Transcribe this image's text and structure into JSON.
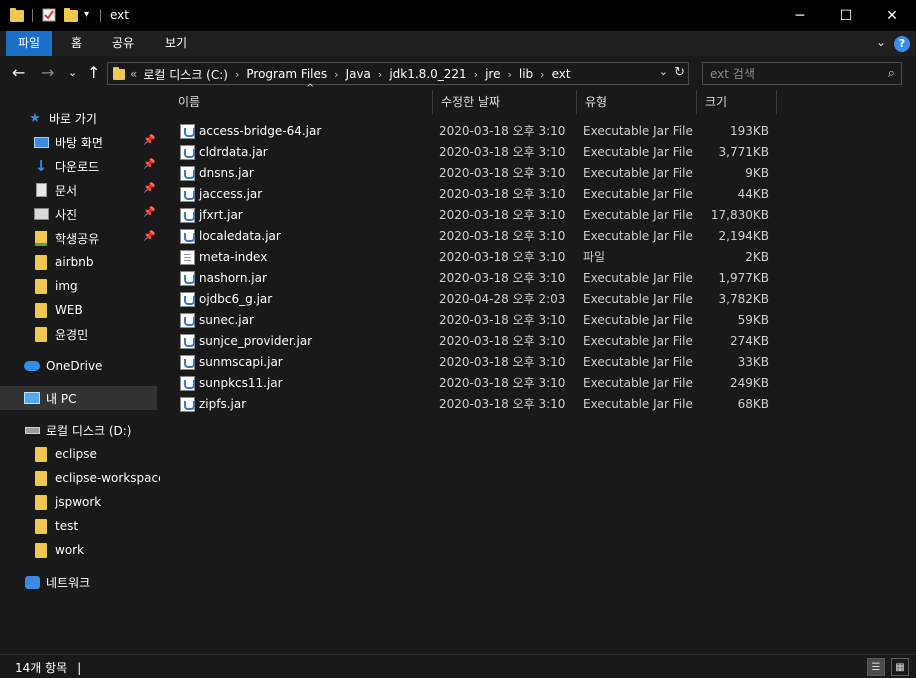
{
  "window": {
    "title": "ext",
    "minimize": "─",
    "maximize": "☐",
    "close": "✕"
  },
  "ribbon": {
    "tabs": [
      {
        "label": "파일",
        "active": true
      },
      {
        "label": "홈"
      },
      {
        "label": "공유"
      },
      {
        "label": "보기"
      }
    ],
    "help": "?"
  },
  "address": {
    "overflow": "«",
    "crumbs": [
      "로컬 디스크 (C:)",
      "Program Files",
      "Java",
      "jdk1.8.0_221",
      "jre",
      "lib",
      "ext"
    ]
  },
  "search": {
    "placeholder": "ext 검색"
  },
  "sidebar": {
    "quick_access": "바로 가기",
    "pinned": [
      {
        "label": "바탕 화면",
        "icon": "desktop-icon"
      },
      {
        "label": "다운로드",
        "icon": "download-icon"
      },
      {
        "label": "문서",
        "icon": "document-icon"
      },
      {
        "label": "사진",
        "icon": "pictures-icon"
      },
      {
        "label": "학생공유",
        "icon": "shared-folder-icon"
      }
    ],
    "folders": [
      "airbnb",
      "img",
      "WEB",
      "윤경민"
    ],
    "onedrive": "OneDrive",
    "this_pc": "내 PC",
    "drive": "로컬 디스크 (D:)",
    "drive_folders": [
      "eclipse",
      "eclipse-workspace",
      "jspwork",
      "test",
      "work"
    ],
    "network": "네트워크"
  },
  "columns": {
    "name": "이름",
    "date": "수정한 날짜",
    "type": "유형",
    "size": "크기"
  },
  "files": [
    {
      "name": "access-bridge-64.jar",
      "date": "2020-03-18 오후 3:10",
      "type": "Executable Jar File",
      "size": "193KB",
      "icon": "jar-icon"
    },
    {
      "name": "cldrdata.jar",
      "date": "2020-03-18 오후 3:10",
      "type": "Executable Jar File",
      "size": "3,771KB",
      "icon": "jar-icon"
    },
    {
      "name": "dnsns.jar",
      "date": "2020-03-18 오후 3:10",
      "type": "Executable Jar File",
      "size": "9KB",
      "icon": "jar-icon"
    },
    {
      "name": "jaccess.jar",
      "date": "2020-03-18 오후 3:10",
      "type": "Executable Jar File",
      "size": "44KB",
      "icon": "jar-icon"
    },
    {
      "name": "jfxrt.jar",
      "date": "2020-03-18 오후 3:10",
      "type": "Executable Jar File",
      "size": "17,830KB",
      "icon": "jar-icon"
    },
    {
      "name": "localedata.jar",
      "date": "2020-03-18 오후 3:10",
      "type": "Executable Jar File",
      "size": "2,194KB",
      "icon": "jar-icon"
    },
    {
      "name": "meta-index",
      "date": "2020-03-18 오후 3:10",
      "type": "파일",
      "size": "2KB",
      "icon": "file-icon"
    },
    {
      "name": "nashorn.jar",
      "date": "2020-03-18 오후 3:10",
      "type": "Executable Jar File",
      "size": "1,977KB",
      "icon": "jar-icon"
    },
    {
      "name": "ojdbc6_g.jar",
      "date": "2020-04-28 오후 2:03",
      "type": "Executable Jar File",
      "size": "3,782KB",
      "icon": "jar-icon"
    },
    {
      "name": "sunec.jar",
      "date": "2020-03-18 오후 3:10",
      "type": "Executable Jar File",
      "size": "59KB",
      "icon": "jar-icon"
    },
    {
      "name": "sunjce_provider.jar",
      "date": "2020-03-18 오후 3:10",
      "type": "Executable Jar File",
      "size": "274KB",
      "icon": "jar-icon"
    },
    {
      "name": "sunmscapi.jar",
      "date": "2020-03-18 오후 3:10",
      "type": "Executable Jar File",
      "size": "33KB",
      "icon": "jar-icon"
    },
    {
      "name": "sunpkcs11.jar",
      "date": "2020-03-18 오후 3:10",
      "type": "Executable Jar File",
      "size": "249KB",
      "icon": "jar-icon"
    },
    {
      "name": "zipfs.jar",
      "date": "2020-03-18 오후 3:10",
      "type": "Executable Jar File",
      "size": "68KB",
      "icon": "jar-icon"
    }
  ],
  "status": {
    "item_count": "14개 항목"
  },
  "colors": {
    "accent": "#1a6fc8",
    "background": "#191919",
    "titlebar": "#000000",
    "folder": "#f0c850"
  }
}
